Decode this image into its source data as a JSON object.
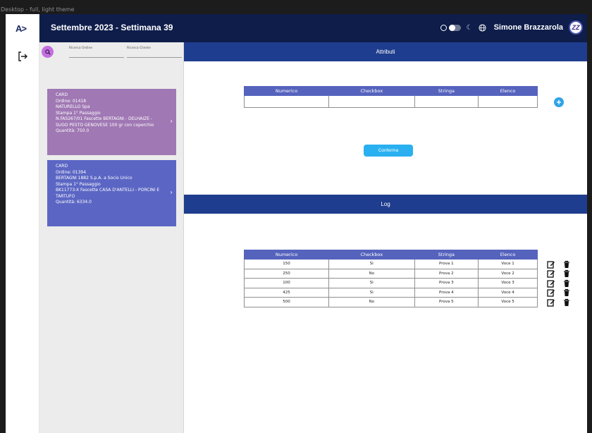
{
  "frame_label": "Desktop - full, light theme",
  "rail": {
    "logo": "A>"
  },
  "header": {
    "title": "Settembre 2023 - Settimana 39",
    "username": "Simone Brazzarola",
    "avatar_initials": "ZZ"
  },
  "sidebar": {
    "search_order_label": "Ricerca Ordine",
    "search_client_label": "Ricerca Cliente",
    "cards": [
      {
        "lines": [
          "CARD",
          "Ordine: 01418",
          "NATURELLO Spa",
          "Stampa 1° Passaggio",
          "N.FAS267/01 Fascette BERTAGNI - DELHAIZE -",
          "SUGO PESTO GENOVESE 100 gr con coperchio",
          "Quantità: 750.0"
        ]
      },
      {
        "lines": [
          "CARD",
          "Ordine: 01394",
          "BERTAGNI 1882 S.p.A. a Socio Unico",
          "Stampa 1° Passaggio",
          "BK11773-X Fascette CASA D'ANTELLI - PORCINI E",
          "TARTUFO",
          "Quantità: 6334.0"
        ]
      }
    ]
  },
  "attributi": {
    "title": "Attributi",
    "headers": [
      "Numerico",
      "Checkbox",
      "Stringa",
      "Elenco"
    ],
    "confirm_label": "Conferma"
  },
  "log": {
    "title": "Log",
    "headers": [
      "Numerico",
      "Checkbox",
      "Stringa",
      "Elenco"
    ],
    "rows": [
      [
        "150",
        "Sì",
        "Prova 1",
        "Voce 1"
      ],
      [
        "250",
        "No",
        "Prova 2",
        "Voce 2"
      ],
      [
        "100",
        "Sì",
        "Prova 3",
        "Voce 3"
      ],
      [
        "425",
        "Sì",
        "Prova 4",
        "Voce 4"
      ],
      [
        "500",
        "No",
        "Prova 5",
        "Voce 5"
      ]
    ]
  }
}
